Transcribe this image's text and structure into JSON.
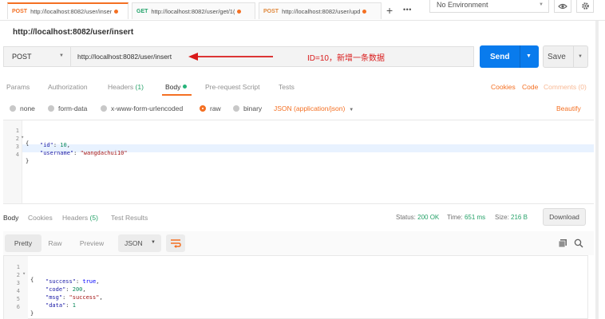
{
  "tabs": [
    {
      "method": "POST",
      "url": "http://localhost:8082/user/inser"
    },
    {
      "method": "GET",
      "url": "http://localhost:8082/user/get/1("
    },
    {
      "method": "POST",
      "url": "http://localhost:8082/user/upd"
    }
  ],
  "toolbar": {
    "plus": "+",
    "more": "•••",
    "environment": "No Environment"
  },
  "request": {
    "title": "http://localhost:8082/user/insert",
    "method": "POST",
    "url": "http://localhost:8082/user/insert",
    "annotation": "ID=10，新增一条数据",
    "send_label": "Send",
    "save_label": "Save"
  },
  "request_tabs": {
    "params": "Params",
    "authorization": "Authorization",
    "headers": "Headers",
    "headers_count": "(1)",
    "body": "Body",
    "prerequest": "Pre-request Script",
    "tests": "Tests",
    "cookies": "Cookies",
    "code": "Code",
    "comments": "Comments (0)"
  },
  "body_types": {
    "none": "none",
    "form_data": "form-data",
    "urlencoded": "x-www-form-urlencoded",
    "raw": "raw",
    "binary": "binary",
    "content_type": "JSON (application/json)",
    "beautify": "Beautify"
  },
  "request_body": {
    "line_numbers": [
      "1",
      "2",
      "3",
      "4"
    ],
    "open": "{",
    "id_key": "\"id\"",
    "id_val": "10",
    "username_key": "\"username\"",
    "username_val": "\"wangdachui10\"",
    "close": "}"
  },
  "response": {
    "tabs": {
      "body": "Body",
      "cookies": "Cookies",
      "headers": "Headers",
      "headers_count": "(5)",
      "test_results": "Test Results"
    },
    "status_label": "Status:",
    "status_value": "200 OK",
    "time_label": "Time:",
    "time_value": "651 ms",
    "size_label": "Size:",
    "size_value": "216 B",
    "download_label": "Download",
    "views": {
      "pretty": "Pretty",
      "raw": "Raw",
      "preview": "Preview",
      "format": "JSON"
    },
    "line_numbers": [
      "1",
      "2",
      "3",
      "4",
      "5",
      "6"
    ],
    "open": "{",
    "success_key": "\"success\"",
    "success_val": "true",
    "code_key": "\"code\"",
    "code_val": "200",
    "msg_key": "\"msg\"",
    "msg_val": "\"success\"",
    "data_key": "\"data\"",
    "data_val": "1",
    "close": "}"
  },
  "colors": {
    "accent": "#f47023",
    "send": "#097bed",
    "annotation": "#d91a1a",
    "ok": "#26a269"
  }
}
